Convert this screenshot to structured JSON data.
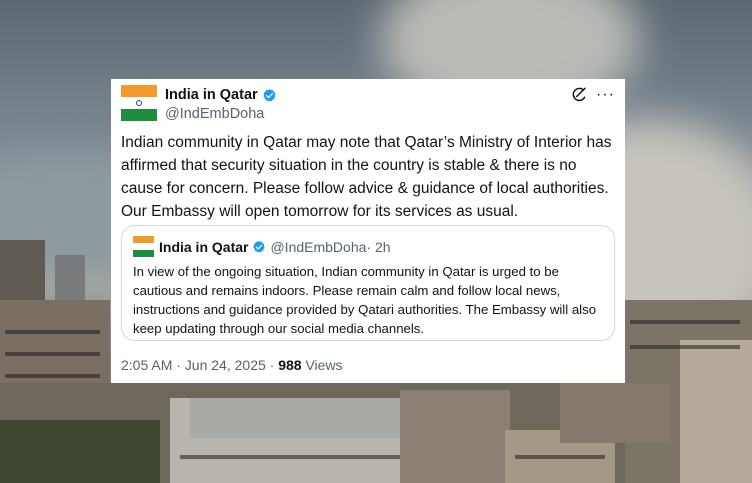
{
  "tweet": {
    "author_name": "India in Qatar",
    "author_handle": "@IndEmbDoha",
    "text": "Indian community in Qatar may note that Qatar’s Ministry of Interior has affirmed that security situation in the country is stable & there is no cause for concern. Please follow advice & guidance of local authorities. Our Embassy will open tomorrow for its services as usual.",
    "timestamp": "2:05 AM · Jun 24, 2025 · ",
    "views_count": "988",
    "views_label": " Views",
    "more_symbol": "···"
  },
  "quoted_tweet": {
    "author_name": "India in Qatar",
    "author_handle": "@IndEmbDoha",
    "age": " · 2h",
    "text": "In view of the ongoing situation, Indian community in Qatar is urged to be cautious and remains indoors. Please remain calm and follow local news, instructions and guidance provided by Qatari authorities. The Embassy will also keep updating through our social media channels."
  },
  "colors": {
    "flag_saffron": "#f39a2f",
    "flag_white": "#ffffff",
    "flag_green": "#1e8e3e",
    "verified_blue": "#1d9bf0",
    "secondary_text": "#536471",
    "primary_text": "#0f1419"
  },
  "icons": [
    "verified-badge-icon",
    "grok-icon",
    "more-options-icon",
    "india-flag-avatar"
  ]
}
